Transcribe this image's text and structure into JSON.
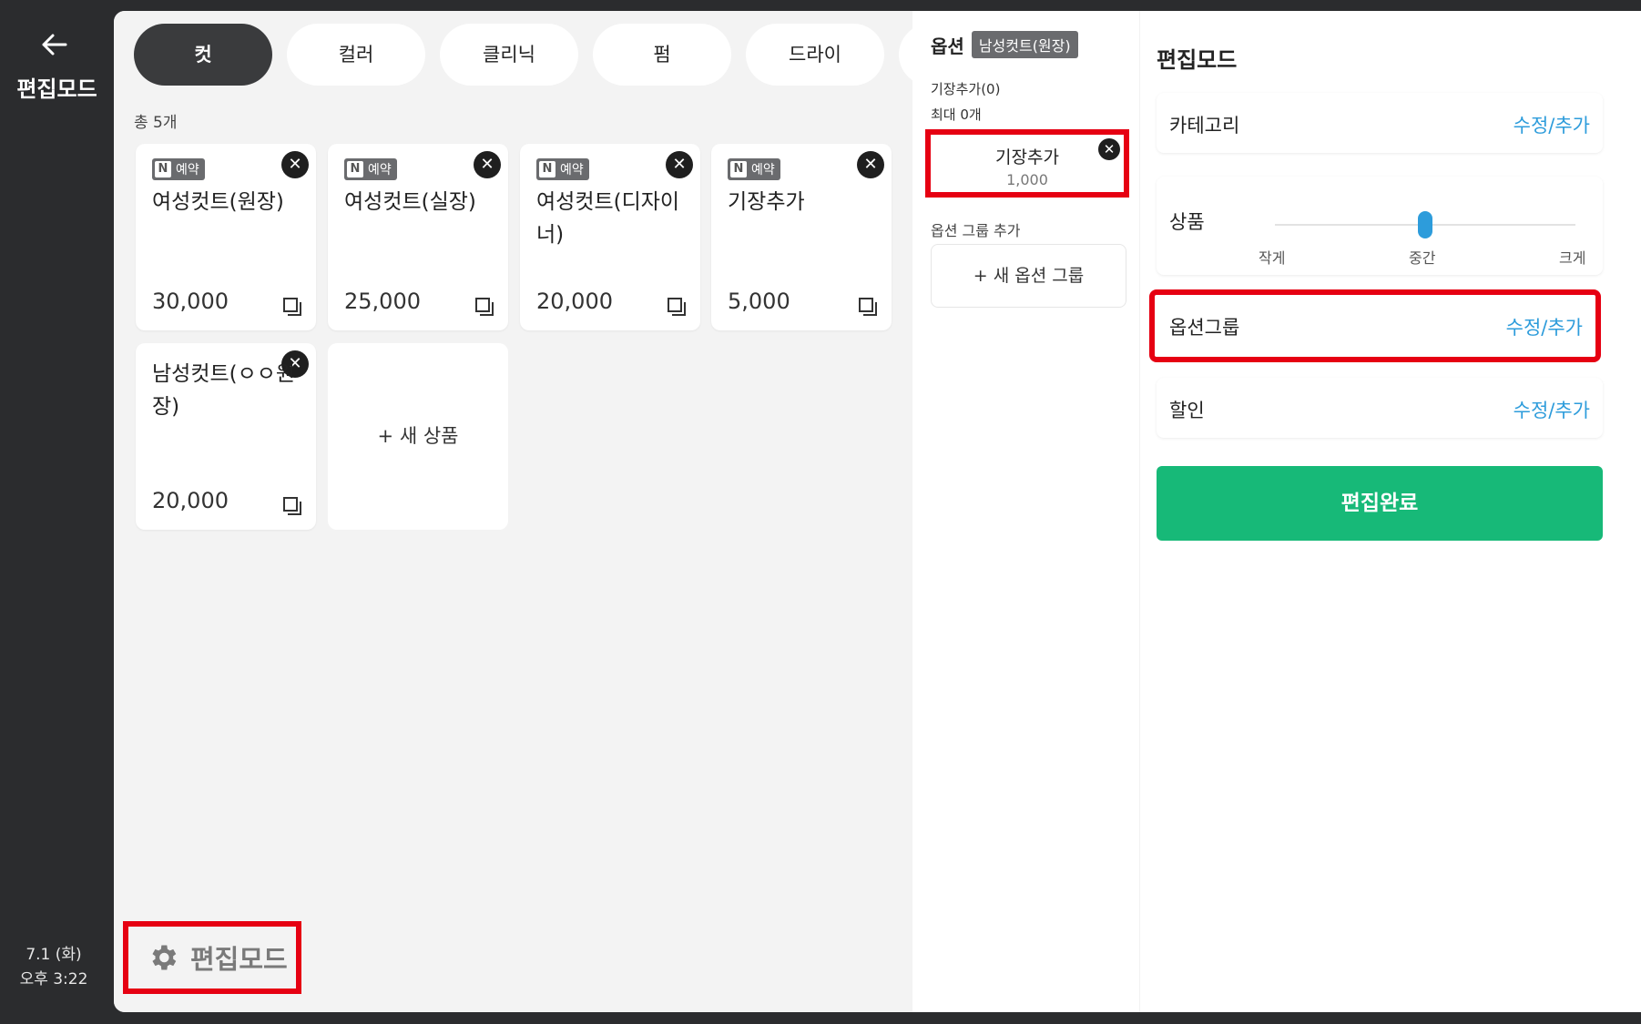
{
  "rail": {
    "title": "편집모드",
    "date": "7.1 (화)",
    "time": "오후 3:22"
  },
  "categories": [
    "컷",
    "컬러",
    "클리닉",
    "펌",
    "드라이"
  ],
  "count": "총 5개",
  "badge": {
    "n": "N",
    "label": "예약"
  },
  "products": [
    {
      "name": "여성컷트(원장)",
      "price": "30,000"
    },
    {
      "name": "여성컷트(실장)",
      "price": "25,000"
    },
    {
      "name": "여성컷트(디자이너)",
      "price": "20,000"
    },
    {
      "name": "기장추가",
      "price": "5,000"
    },
    {
      "name": "남성컷트(ㅇㅇ원장)",
      "price": "20,000"
    }
  ],
  "new_product": "+ 새 상품",
  "edit_mode_button": "편집모드",
  "options": {
    "title": "옵션",
    "tag": "남성컷트(원장)",
    "group_name": "기장추가(0)",
    "max": "최대 0개",
    "item": {
      "name": "기장추가",
      "price": "1,000"
    },
    "add_group_label": "옵션 그룹 추가",
    "new_group": "+ 새 옵션 그룹"
  },
  "edit_panel": {
    "title": "편집모드",
    "category": {
      "label": "카테고리",
      "action": "수정/추가"
    },
    "product_size": {
      "label": "상품",
      "small": "작게",
      "medium": "중간",
      "large": "크게",
      "level": 0.5
    },
    "option_group": {
      "label": "옵션그룹",
      "action": "수정/추가"
    },
    "discount": {
      "label": "할인",
      "action": "수정/추가"
    },
    "done": "편집완료"
  },
  "colors": {
    "accent": "#2d9cdb",
    "done": "#17b978",
    "highlight": "#e60012"
  }
}
